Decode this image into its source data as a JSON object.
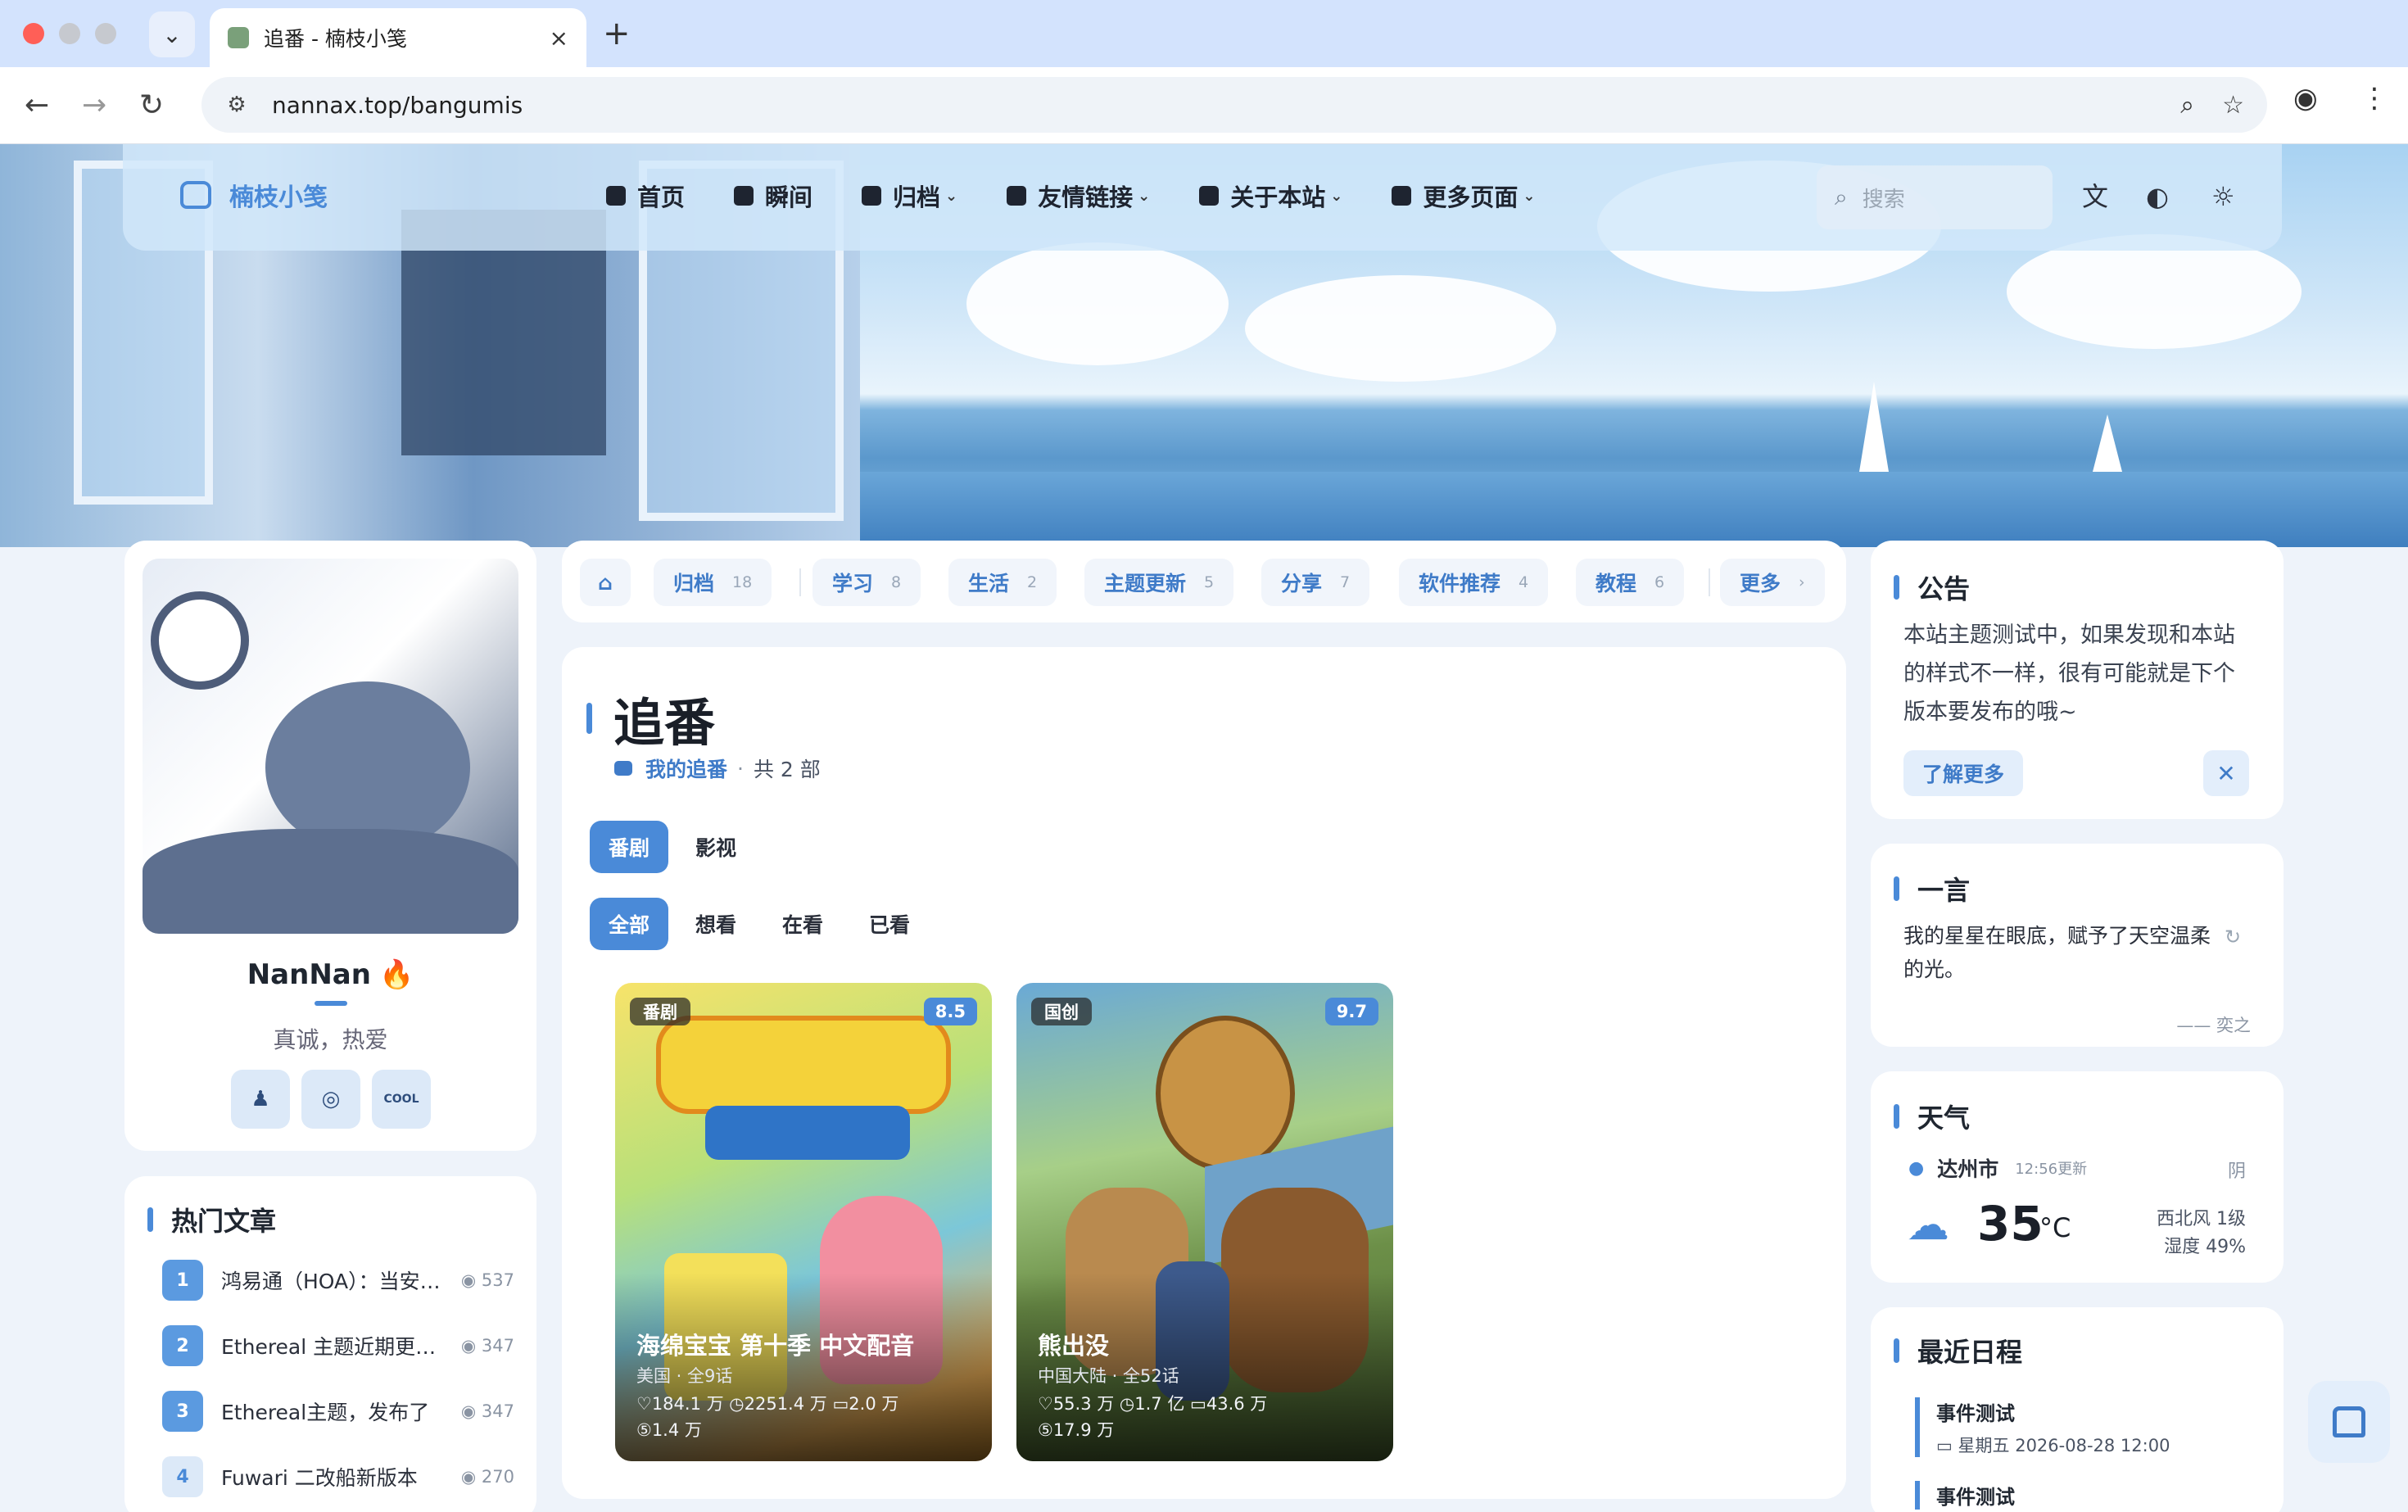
{
  "browser": {
    "tab_title": "追番 - 楠枝小笺",
    "url": "nannax.top/bangumis",
    "new_tab": "+",
    "close_tab": "×"
  },
  "header": {
    "site_name": "楠枝小笺",
    "menu": [
      {
        "label": "首页",
        "has_dropdown": false
      },
      {
        "label": "瞬间",
        "has_dropdown": false
      },
      {
        "label": "归档",
        "has_dropdown": true
      },
      {
        "label": "友情链接",
        "has_dropdown": true
      },
      {
        "label": "关于本站",
        "has_dropdown": true
      },
      {
        "label": "更多页面",
        "has_dropdown": true
      }
    ],
    "search_placeholder": "搜索"
  },
  "profile": {
    "name": "NanNan",
    "motto": "真诚，热爱",
    "social": [
      "qq-icon",
      "github-icon",
      "coolapk-icon"
    ],
    "cool_label": "COOL"
  },
  "hot": {
    "title": "热门文章",
    "items": [
      {
        "rank": "1",
        "title": "鸿易通（HOA）：当安…",
        "views": "537"
      },
      {
        "rank": "2",
        "title": "Ethereal 主题近期更…",
        "views": "347"
      },
      {
        "rank": "3",
        "title": "Ethereal主题，发布了",
        "views": "347"
      },
      {
        "rank": "4",
        "title": "Fuwari 二改船新版本",
        "views": "270"
      }
    ]
  },
  "categories": [
    {
      "label": "归档",
      "count": "18"
    },
    {
      "label": "学习",
      "count": "8"
    },
    {
      "label": "生活",
      "count": "2"
    },
    {
      "label": "主题更新",
      "count": "5"
    },
    {
      "label": "分享",
      "count": "7"
    },
    {
      "label": "软件推荐",
      "count": "4"
    },
    {
      "label": "教程",
      "count": "6"
    },
    {
      "label": "更多",
      "count": "›"
    }
  ],
  "page": {
    "title": "追番",
    "subtitle_link": "我的追番",
    "subtitle_sep": "·",
    "subtitle_count": "共 2 部",
    "type_tabs": [
      "番剧",
      "影视"
    ],
    "status_tabs": [
      "全部",
      "想看",
      "在看",
      "已看"
    ],
    "items": [
      {
        "tag": "番剧",
        "score": "8.5",
        "title": "海绵宝宝 第十季 中文配音",
        "meta": "美国 · 全9话",
        "stats": "♡184.1 万 ◷2251.4 万 ▭2.0 万",
        "stats2": "⑤1.4 万"
      },
      {
        "tag": "国创",
        "score": "9.7",
        "title": "熊出没",
        "meta": "中国大陆 · 全52话",
        "stats": "♡55.3 万 ◷1.7 亿 ▭43.6 万",
        "stats2": "⑤17.9 万"
      }
    ]
  },
  "notice": {
    "title": "公告",
    "body": "本站主题测试中，如果发现和本站的样式不一样，很有可能就是下个版本要发布的哦~",
    "button": "了解更多",
    "close": "✕"
  },
  "hitokoto": {
    "title": "一言",
    "quote": "我的星星在眼底，赋予了天空温柔的光。",
    "from": "—— 奕之"
  },
  "weather": {
    "title": "天气",
    "city": "达州市",
    "updated": "12:56更新",
    "condition": "阴",
    "temp": "35",
    "unit": "°C",
    "wind": "西北风 1级",
    "humidity": "湿度 49%"
  },
  "schedule": {
    "title": "最近日程",
    "events": [
      {
        "name": "事件测试",
        "date": "星期五 2026-08-28 12:00"
      },
      {
        "name": "事件测试",
        "date": ""
      }
    ]
  },
  "colors": {
    "accent": "#4a8ad8",
    "page_bg": "#eef3fa"
  }
}
